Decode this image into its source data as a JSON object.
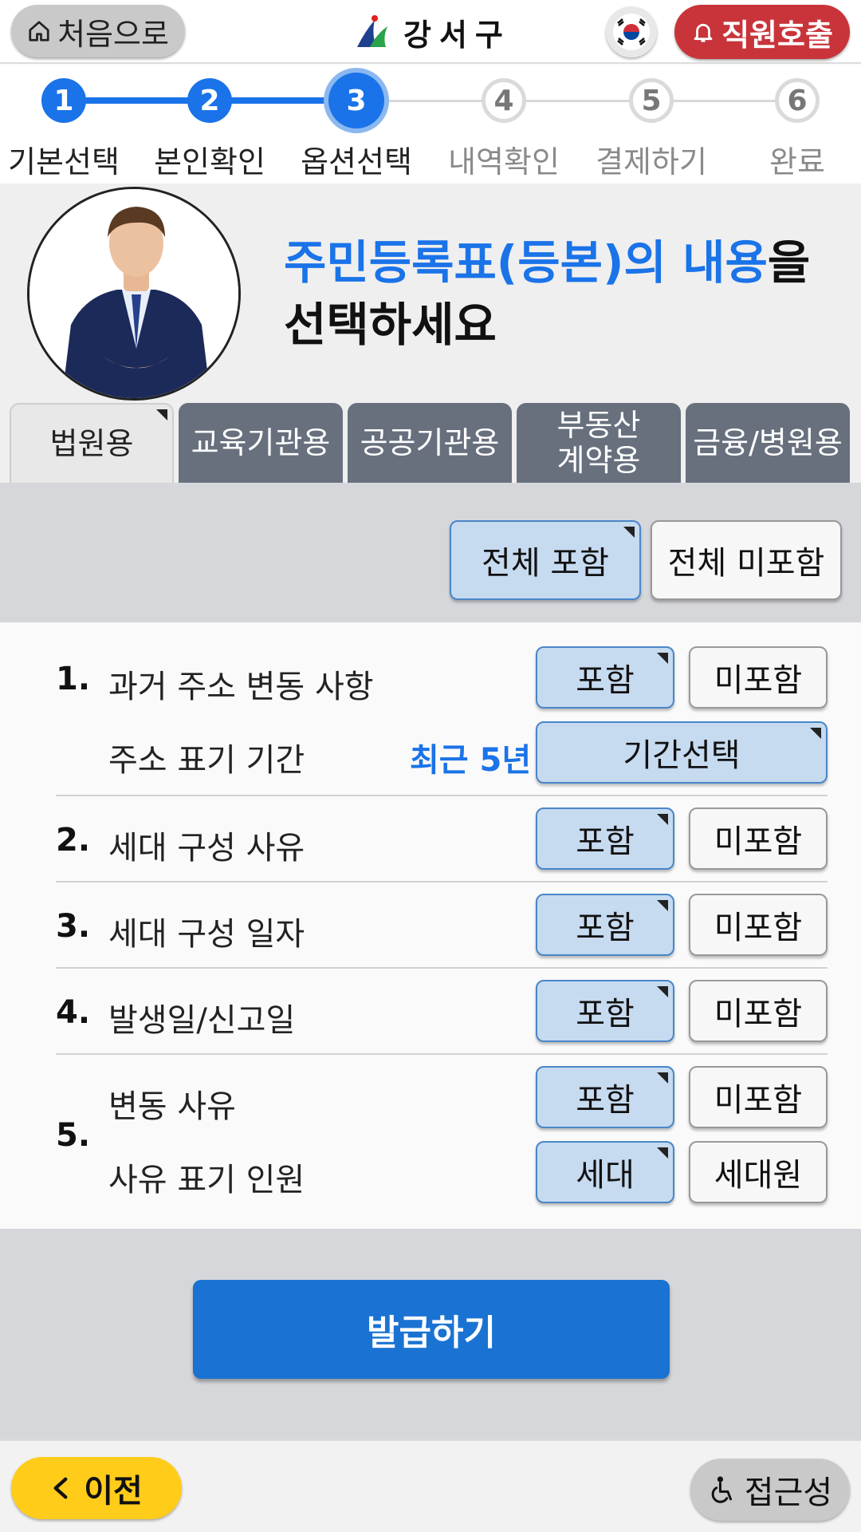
{
  "header": {
    "home_label": "처음으로",
    "logo_text": "강서구",
    "call_label": "직원호출"
  },
  "stepper": {
    "steps": [
      {
        "num": "1",
        "label": "기본선택",
        "state": "done"
      },
      {
        "num": "2",
        "label": "본인확인",
        "state": "done"
      },
      {
        "num": "3",
        "label": "옵션선택",
        "state": "current"
      },
      {
        "num": "4",
        "label": "내역확인",
        "state": "todo"
      },
      {
        "num": "5",
        "label": "결제하기",
        "state": "todo"
      },
      {
        "num": "6",
        "label": "완료",
        "state": "todo"
      }
    ]
  },
  "intro": {
    "title_highlight": "주민등록표(등본)의 내용",
    "title_rest_1": "을",
    "title_line2": "선택하세요"
  },
  "tabs": [
    {
      "label": "법원용",
      "active": true
    },
    {
      "label": "교육기관용",
      "active": false
    },
    {
      "label": "공공기관용",
      "active": false
    },
    {
      "label": "부동산\n계약용",
      "active": false
    },
    {
      "label": "금융/병원용",
      "active": false
    }
  ],
  "all_buttons": {
    "include_all": "전체 포함",
    "exclude_all": "전체 미포함"
  },
  "options": {
    "items": [
      {
        "num": "1.",
        "label": "과거 주소 변동 사항",
        "include": "포함",
        "exclude": "미포함"
      },
      {
        "label": "주소 표기 기간",
        "value": "최근 5년",
        "button": "기간선택"
      },
      {
        "num": "2.",
        "label": "세대 구성 사유",
        "include": "포함",
        "exclude": "미포함"
      },
      {
        "num": "3.",
        "label": "세대 구성 일자",
        "include": "포함",
        "exclude": "미포함"
      },
      {
        "num": "4.",
        "label": "발생일/신고일",
        "include": "포함",
        "exclude": "미포함"
      },
      {
        "num": "5.",
        "label": "변동 사유",
        "include": "포함",
        "exclude": "미포함"
      },
      {
        "label": "사유 표기 인원",
        "include": "세대",
        "exclude": "세대원"
      }
    ]
  },
  "issue_label": "발급하기",
  "footer": {
    "prev_label": "이전",
    "accessibility_label": "접근성"
  },
  "colors": {
    "accent": "#1a73e8",
    "call": "#c8343a",
    "prev": "#ffcc1a"
  }
}
